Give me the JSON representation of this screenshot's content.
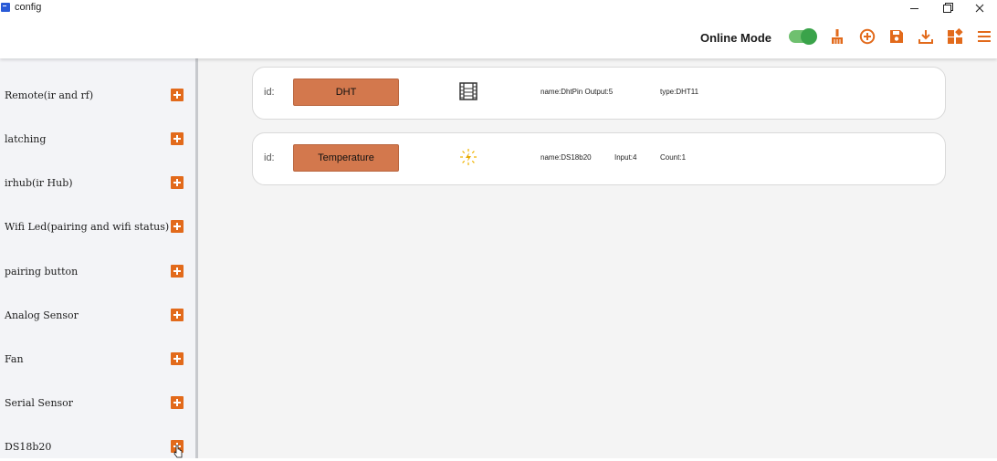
{
  "window": {
    "title": "config"
  },
  "toolbar": {
    "mode_label": "Online Mode",
    "toggle_on": true,
    "accent": "#e26a1b",
    "toggle_color": "#3aa34a",
    "icons": [
      "broom-icon",
      "add-circle-icon",
      "save-icon",
      "download-icon",
      "widgets-icon",
      "menu-icon"
    ]
  },
  "sidebar": {
    "items": [
      {
        "label": "Remote(ir and rf)"
      },
      {
        "label": "latching"
      },
      {
        "label": "irhub(ir Hub)"
      },
      {
        "label": "Wifi Led(pairing and wifi status)"
      },
      {
        "label": "pairing button"
      },
      {
        "label": "Analog Sensor"
      },
      {
        "label": "Fan"
      },
      {
        "label": "Serial Sensor"
      },
      {
        "label": "DS18b20"
      }
    ]
  },
  "cards": [
    {
      "id_label": "id:",
      "chip": "DHT",
      "icon": "film-strip-icon",
      "name": "name:DhtPin Output:5",
      "type": "type:DHT11"
    },
    {
      "id_label": "id:",
      "chip": "Temperature",
      "icon": "sun-bolt-icon",
      "name": "name:DS18b20",
      "input": "Input:4",
      "count": "Count:1"
    }
  ]
}
